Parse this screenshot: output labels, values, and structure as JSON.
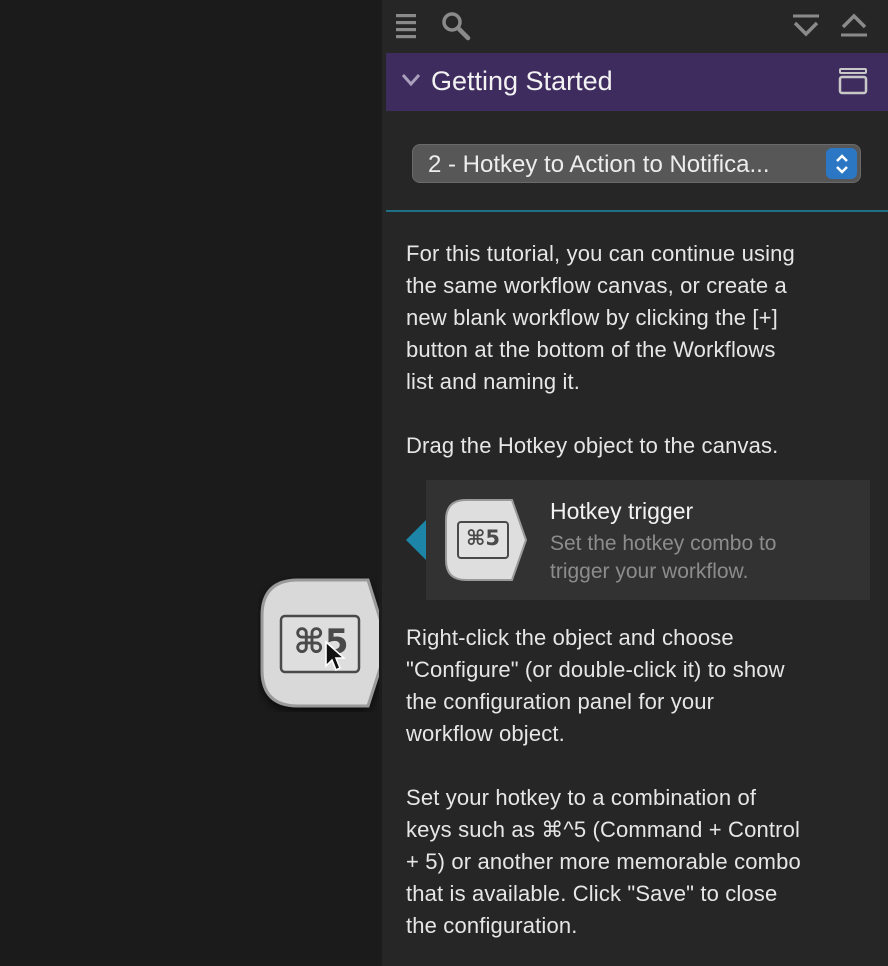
{
  "toolbar": {
    "left_icons": [
      "list-icon",
      "search-icon"
    ],
    "right_icons": [
      "collapse-all-icon",
      "expand-all-icon"
    ]
  },
  "header": {
    "title": "Getting Started",
    "color": "#3f2c5f"
  },
  "dropdown": {
    "selected": "2 - Hotkey to Action to Notifica..."
  },
  "content": {
    "intro": [
      "For this tutorial, you can continue using",
      "the same workflow canvas, or create a",
      "new blank workflow by clicking the [+]",
      "button at the bottom of the Workflows",
      "list and naming it."
    ],
    "drag_instruction": "Drag the Hotkey object to the canvas.",
    "card": {
      "icon_label": "⌘5",
      "title": "Hotkey trigger",
      "subtitle": [
        "Set the hotkey combo to",
        "trigger your workflow."
      ]
    },
    "configure": [
      "Right-click the object and choose",
      "\"Configure\" (or double-click it) to show",
      "the configuration panel for your",
      "workflow object."
    ],
    "set_hotkey": [
      "Set your hotkey to a combination of",
      "keys such as ⌘^5 (Command + Control",
      "+ 5) or another more memorable combo",
      "that is available. Click \"Save\" to close",
      "the configuration."
    ]
  },
  "canvas": {
    "dragged_object_label": "⌘5"
  },
  "colors": {
    "accent": "#1c85a8",
    "dropdown_button": "#2b77c4"
  }
}
